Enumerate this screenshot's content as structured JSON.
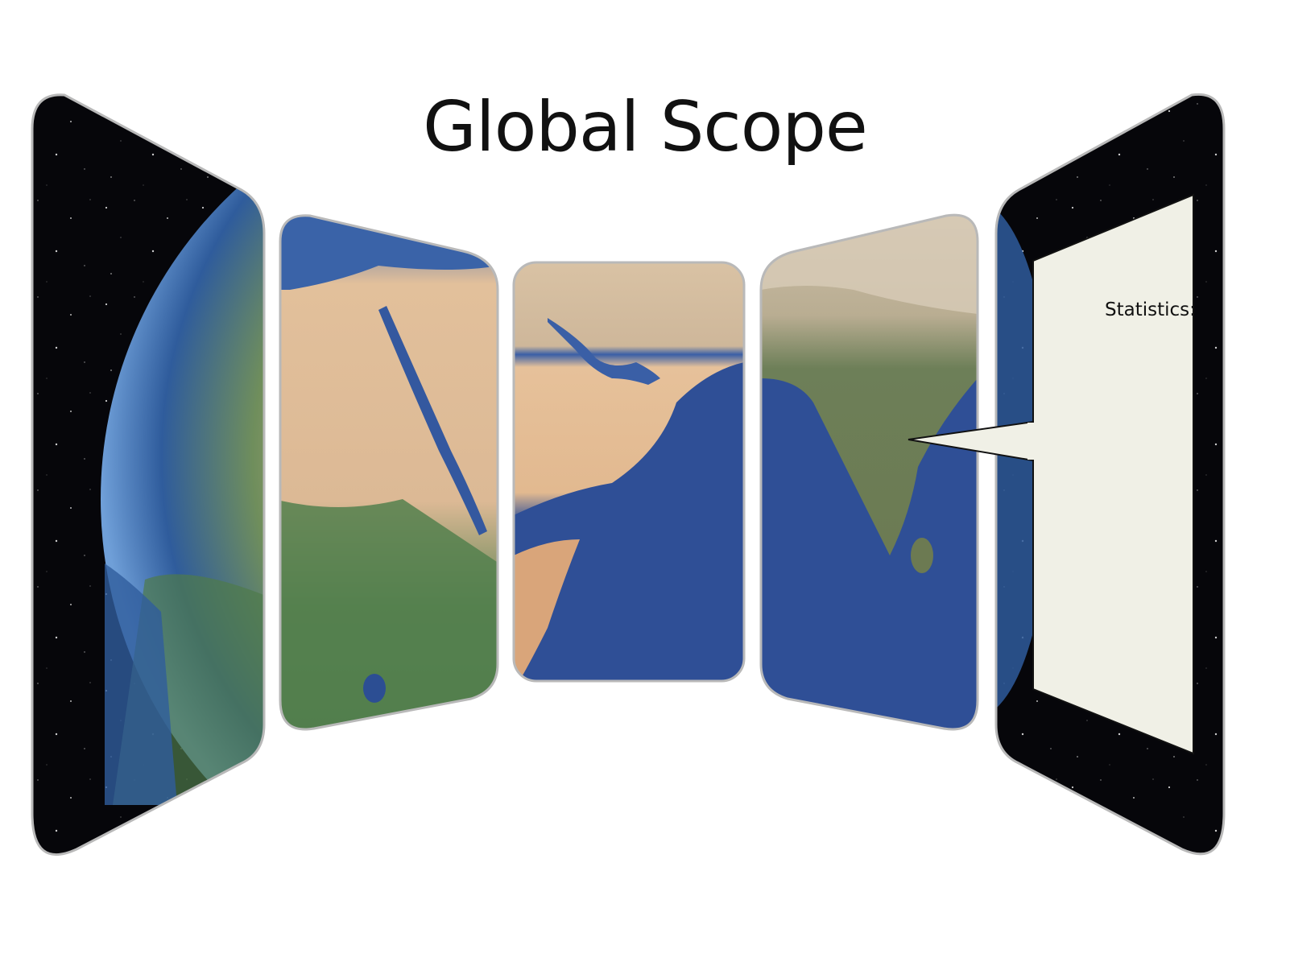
{
  "title": "Global Scope",
  "stats": {
    "label": "Statistics:"
  },
  "colors": {
    "space": "#06060a",
    "ocean": "#2f4f96",
    "desert": "#e3c29c",
    "vegetation": "#4f7a4a",
    "frame_stroke": "#b9b9b9",
    "stats_panel": "#f0f0e6"
  },
  "panels": [
    {
      "name": "left-globe-panel",
      "content": "globe-edge-africa"
    },
    {
      "name": "north-africa-panel",
      "content": "north-africa-map"
    },
    {
      "name": "arabia-panel",
      "content": "arabian-peninsula-map"
    },
    {
      "name": "india-panel",
      "content": "indian-subcontinent-map"
    },
    {
      "name": "right-space-panel",
      "content": "statistics-callout"
    }
  ]
}
